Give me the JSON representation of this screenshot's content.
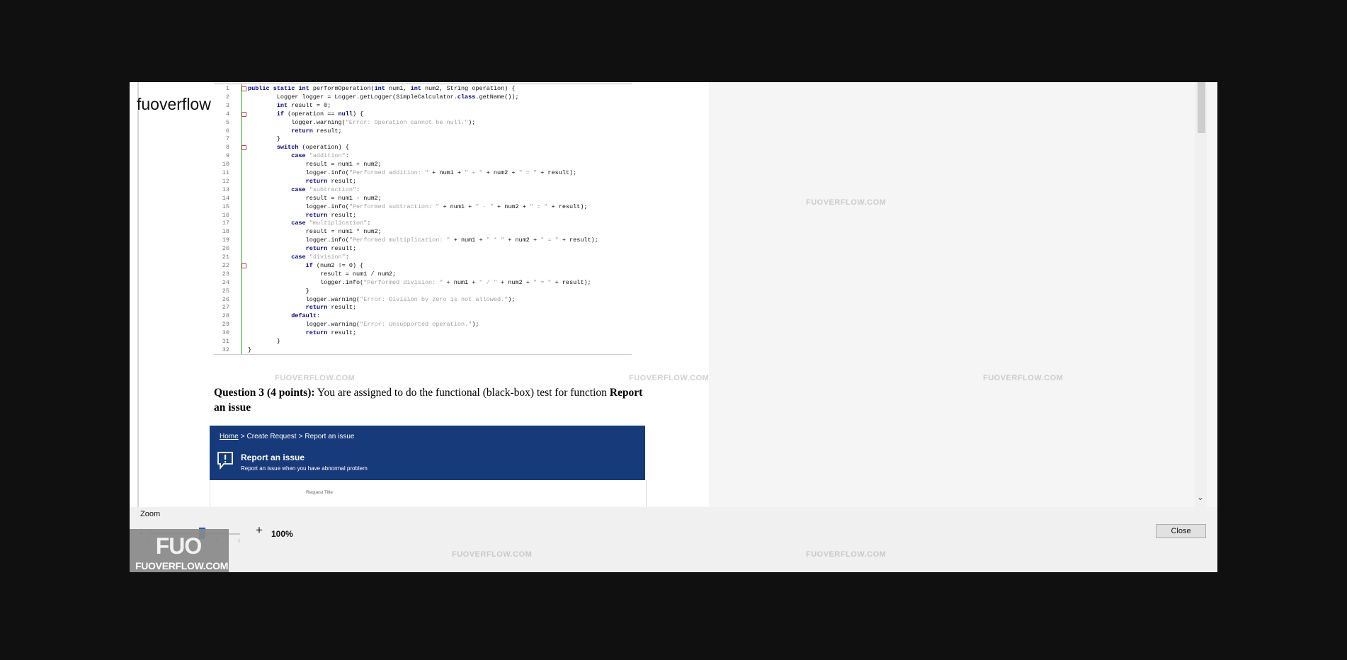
{
  "brand": "fuoverflow",
  "code": {
    "line_numbers": [
      "1",
      "2",
      "3",
      "4",
      "5",
      "6",
      "7",
      "8",
      "9",
      "10",
      "11",
      "12",
      "13",
      "14",
      "15",
      "16",
      "17",
      "18",
      "19",
      "20",
      "21",
      "22",
      "23",
      "24",
      "25",
      "26",
      "27",
      "28",
      "29",
      "30",
      "31",
      "32"
    ],
    "lines": [
      "public static int performOperation(int num1, int num2, String operation) {",
      "        Logger logger = Logger.getLogger(SimpleCalculator.class.getName());",
      "        int result = 0;",
      "        if (operation == null) {",
      "            logger.warning(\"Error: Operation cannot be null.\");",
      "            return result;",
      "        }",
      "        switch (operation) {",
      "            case \"addition\":",
      "                result = num1 + num2;",
      "                logger.info(\"Performed addition: \" + num1 + \" + \" + num2 + \" = \" + result);",
      "                return result;",
      "            case \"subtraction\":",
      "                result = num1 - num2;",
      "                logger.info(\"Performed subtraction: \" + num1 + \" - \" + num2 + \" = \" + result);",
      "                return result;",
      "            case \"multiplication\":",
      "                result = num1 * num2;",
      "                logger.info(\"Performed multiplication: \" + num1 + \" * \" + num2 + \" = \" + result);",
      "                return result;",
      "            case \"division\":",
      "                if (num2 != 0) {",
      "                    result = num1 / num2;",
      "                    logger.info(\"Performed division: \" + num1 + \" / \" + num2 + \" = \" + result);",
      "                }",
      "                logger.warning(\"Error: Division by zero is not allowed.\");",
      "                return result;",
      "            default:",
      "                logger.warning(\"Error: Unsupported operation.\");",
      "                return result;",
      "        }",
      "}"
    ]
  },
  "question": {
    "lead": "Question 3 (4 points):",
    "body": " You are assigned to do the functional (black-box) test for function ",
    "target": "Report an issue"
  },
  "banner": {
    "breadcrumb_home": "Home",
    "breadcrumb_sep": ">",
    "breadcrumb_2": "Create Request",
    "breadcrumb_3": "Report an issue",
    "title": "Report an issue",
    "subtitle": "Report an issue when you have abnormal problem",
    "form_label": "Request Title"
  },
  "zoom": {
    "label": "Zoom",
    "minus": "-",
    "plus": "+",
    "value": "100%",
    "level": 1.0
  },
  "close_label": "Close",
  "watermark": {
    "logo_mark": "FUO",
    "logo_text": "FUOVERFLOW.COM",
    "text": "FUOVERFLOW.COM"
  },
  "colors": {
    "banner": "#173a7b",
    "slider_thumb": "#1e5db3",
    "keyword": "#000080",
    "string": "#a0a0a0"
  },
  "icons": {
    "banner_icon": "alert-speech-bubble-icon",
    "scroll_down": "chevron-down-icon"
  }
}
